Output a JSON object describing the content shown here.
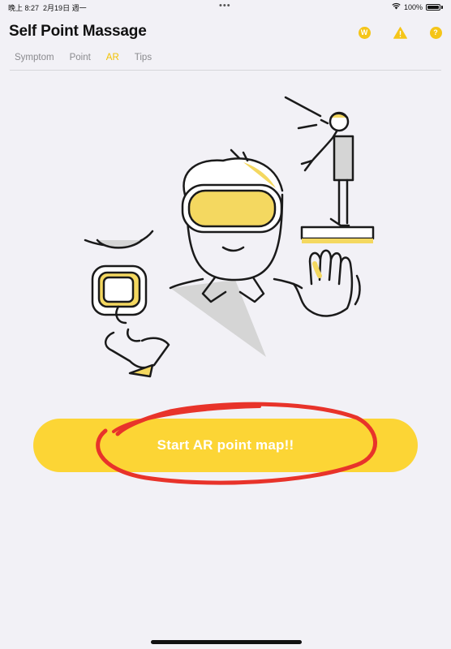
{
  "status_bar": {
    "time": "晚上 8:27",
    "date": "2月19日 週一",
    "battery": "100%"
  },
  "header": {
    "title": "Self Point Massage",
    "icons": [
      "w-badge-icon",
      "warning-icon",
      "help-icon"
    ],
    "w_badge_text": "W",
    "help_text": "?"
  },
  "tabs": [
    {
      "label": "Symptom"
    },
    {
      "label": "Point"
    },
    {
      "label": "AR"
    },
    {
      "label": "Tips"
    }
  ],
  "active_tab": "AR",
  "main": {
    "cta_label": "Start AR point map!!"
  },
  "colors": {
    "accent": "#f2c300",
    "button": "#fcd535",
    "annotation": "#e8332a",
    "background": "#f2f1f6"
  }
}
